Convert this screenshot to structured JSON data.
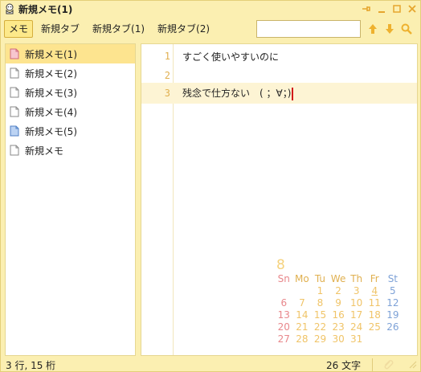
{
  "window": {
    "title": "新規メモ(1)"
  },
  "toolbar": {
    "tabs": [
      {
        "label": "メモ",
        "active": true
      },
      {
        "label": "新規タブ",
        "active": false
      },
      {
        "label": "新規タブ(1)",
        "active": false
      },
      {
        "label": "新規タブ(2)",
        "active": false
      }
    ],
    "search_value": ""
  },
  "sidebar": {
    "items": [
      {
        "label": "新規メモ(1)",
        "icon": "pink-doc-icon",
        "selected": true
      },
      {
        "label": "新規メモ(2)",
        "icon": "doc-icon",
        "selected": false
      },
      {
        "label": "新規メモ(3)",
        "icon": "doc-icon",
        "selected": false
      },
      {
        "label": "新規メモ(4)",
        "icon": "doc-icon",
        "selected": false
      },
      {
        "label": "新規メモ(5)",
        "icon": "blue-doc-icon",
        "selected": false
      },
      {
        "label": "新規メモ",
        "icon": "doc-icon",
        "selected": false
      }
    ]
  },
  "editor": {
    "lines": [
      {
        "num": "1",
        "text": "すごく使いやすいのに"
      },
      {
        "num": "2",
        "text": ""
      },
      {
        "num": "3",
        "text": "残念で仕方ない　( ；∀；)"
      }
    ],
    "current_line": 3
  },
  "calendar": {
    "month": "8",
    "weekdays": [
      "Sn",
      "Mo",
      "Tu",
      "We",
      "Th",
      "Fr",
      "St"
    ],
    "weeks": [
      [
        "",
        "",
        "1",
        "2",
        "3",
        "4",
        "5"
      ],
      [
        "6",
        "7",
        "8",
        "9",
        "10",
        "11",
        "12"
      ],
      [
        "13",
        "14",
        "15",
        "16",
        "17",
        "18",
        "19"
      ],
      [
        "20",
        "21",
        "22",
        "23",
        "24",
        "25",
        "26"
      ],
      [
        "27",
        "28",
        "29",
        "30",
        "31",
        "",
        ""
      ]
    ],
    "today": "4"
  },
  "status": {
    "position": "3 行, 15 桁",
    "char_count": "26 文字"
  },
  "colors": {
    "background": "#fbefb1",
    "accent": "#fde48f",
    "caret": "#d21a1a",
    "sunday": "#e8888c",
    "saturday": "#7ea2d7",
    "weekday": "#f0c468"
  }
}
